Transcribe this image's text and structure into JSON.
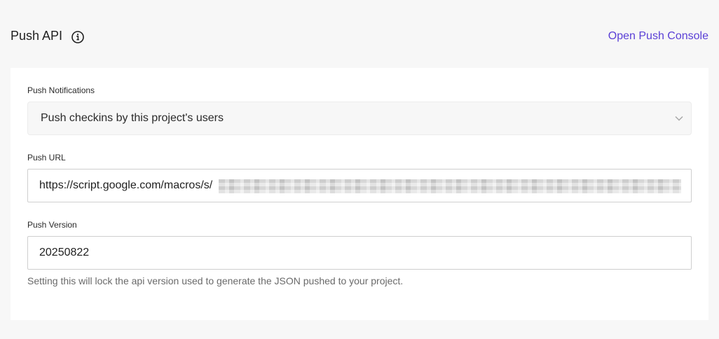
{
  "header": {
    "title": "Push API",
    "info_icon": "info-circle-icon",
    "console_link": "Open Push Console"
  },
  "push_notifications": {
    "label": "Push Notifications",
    "selected": "Push checkins by this project's users",
    "chevron_icon": "chevron-down-icon"
  },
  "push_url": {
    "label": "Push URL",
    "value": "https://script.google.com/macros/s/",
    "redacted": true
  },
  "push_version": {
    "label": "Push Version",
    "value": "20250822",
    "help": "Setting this will lock the api version used to generate the JSON pushed to your project."
  },
  "colors": {
    "accent": "#5a3fd6",
    "page_bg": "#f7f7f7",
    "card_bg": "#ffffff",
    "input_border": "#cfcfcf",
    "help_text": "#6a6a6a"
  }
}
